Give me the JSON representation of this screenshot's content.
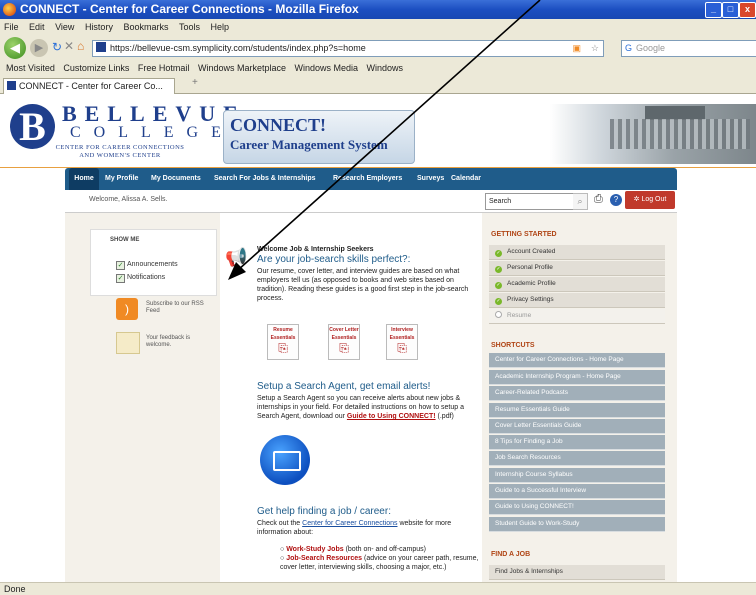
{
  "window": {
    "title": "CONNECT - Center for Career Connections - Mozilla Firefox",
    "min": "_",
    "max": "□",
    "close": "x"
  },
  "menu": [
    "File",
    "Edit",
    "View",
    "History",
    "Bookmarks",
    "Tools",
    "Help"
  ],
  "nav": {
    "url": "https://bellevue-csm.symplicity.com/students/index.php?s=home",
    "search_placeholder": "Google"
  },
  "bookmarks": [
    "Most Visited",
    "Customize Links",
    "Free Hotmail",
    "Windows Marketplace",
    "Windows Media",
    "Windows"
  ],
  "tab": {
    "label": "CONNECT - Center for Career Co...",
    "new": "+"
  },
  "status": "Done",
  "header": {
    "logo_letter": "B",
    "logo_line1": "BELLEVUE",
    "logo_line2": "COLLEGE",
    "logo_sub1": "CENTER FOR CAREER CONNECTIONS",
    "logo_sub2": "AND WOMEN'S CENTER",
    "connect_title": "CONNECT!",
    "connect_subtitle": "Career Management System"
  },
  "mainnav": [
    "Home",
    "My Profile",
    "My Documents",
    "Search For Jobs & Internships",
    "Research Employers",
    "Surveys",
    "Calendar"
  ],
  "subbar": {
    "welcome": "Welcome, Alissa A. Sells.",
    "search_value": "Search",
    "logout": "Log Out"
  },
  "sidebar": {
    "show_me": "SHOW ME",
    "items": [
      "Announcements",
      "Notifications"
    ],
    "rss": "Subscribe to our RSS Feed",
    "feedback": "Your feedback is welcome."
  },
  "center": {
    "welcome_title": "Welcome Job & Internship Seekers",
    "headline1": "Are your job-search skills perfect?:",
    "body1": "Our resume, cover letter, and interview guides are based on what employers tell us (as opposed to books and web sites based on tradition). Reading these guides is a good first step in the job-search process.",
    "pdfs": [
      {
        "l1": "Resume",
        "l2": "Essentials"
      },
      {
        "l1": "Cover Letter",
        "l2": "Essentials"
      },
      {
        "l1": "Interview",
        "l2": "Essentials"
      }
    ],
    "headline2": "Setup a Search Agent, get email alerts!",
    "body2": "Setup a Search Agent so you can receive alerts about new jobs & internships in your field. For detailed instructions on how to setup a Search Agent, download our",
    "body2_link": "Guide to Using CONNECT!",
    "body2_tail": "(.pdf)",
    "headline3": "Get help finding a job / career:",
    "body3": "Check out the",
    "body3_link": "Center for Career Connections",
    "body3_tail": "website for more information about:",
    "bullets": [
      {
        "bold": "Work-Study Jobs",
        "rest": "(both on- and off-campus)"
      },
      {
        "bold": "Job-Search Resources",
        "rest": "(advice on your career path, resume, cover letter, interviewing skills, choosing a major, etc.)"
      }
    ]
  },
  "right": {
    "getting_started": "GETTING STARTED",
    "steps": [
      {
        "label": "Account Created",
        "done": true
      },
      {
        "label": "Personal Profile",
        "done": true
      },
      {
        "label": "Academic Profile",
        "done": true
      },
      {
        "label": "Privacy Settings",
        "done": true
      },
      {
        "label": "Resume",
        "done": false
      }
    ],
    "shortcuts": "SHORTCUTS",
    "links": [
      "Center for Career Connections - Home Page",
      "Academic Internship Program - Home Page",
      "Career-Related Podcasts",
      "Resume Essentials Guide",
      "Cover Letter Essentials Guide",
      "8 Tips for Finding a Job",
      "Job Search Resources",
      "Internship Course Syllabus",
      "Guide to a Successful Interview",
      "Guide to Using CONNECT!",
      "Student Guide to Work-Study"
    ],
    "find_job": "FIND A JOB",
    "find_links": [
      "Find Jobs & Internships"
    ]
  },
  "colors": {
    "nav_blue": "#1f5c8a",
    "link_gray": "#a1afb9",
    "heading_orange": "#b04515",
    "logout_red": "#c0392b"
  }
}
